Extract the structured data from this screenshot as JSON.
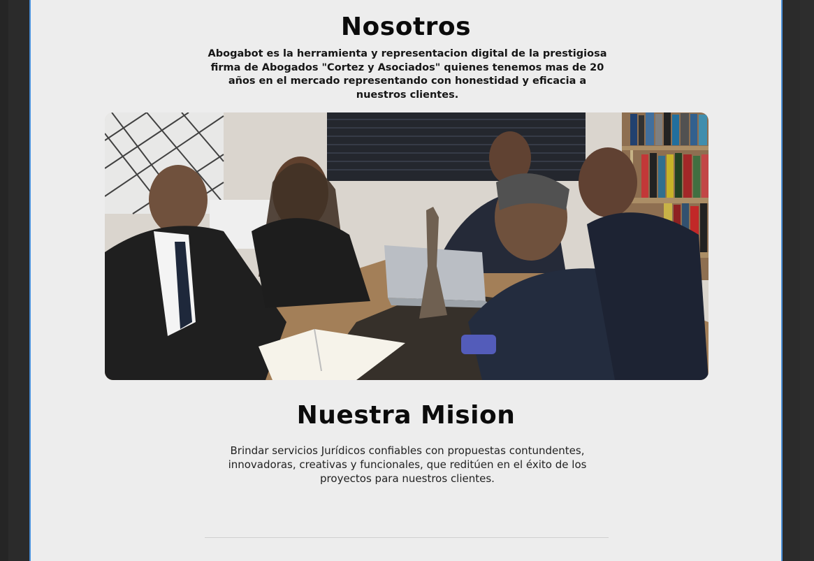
{
  "about": {
    "title": "Nosotros",
    "description": "Abogabot es la herramienta y representacion digital de la prestigiosa firma de Abogados \"Cortez y Asociados\" quienes tenemos mas de 20 años en el mercado representando con honestidad y eficacia a nuestros clientes."
  },
  "mission": {
    "title": "Nuestra Mision",
    "description": "Brindar servicios Jurídicos confiables con propuestas contundentes, innovadoras, creativas y funcionales, que reditúen en el éxito de los proyectos para nuestros clientes."
  },
  "colors": {
    "page_bg": "#ededed",
    "outer_bg": "#2b2b2b",
    "accent_border": "#4a90d9"
  }
}
